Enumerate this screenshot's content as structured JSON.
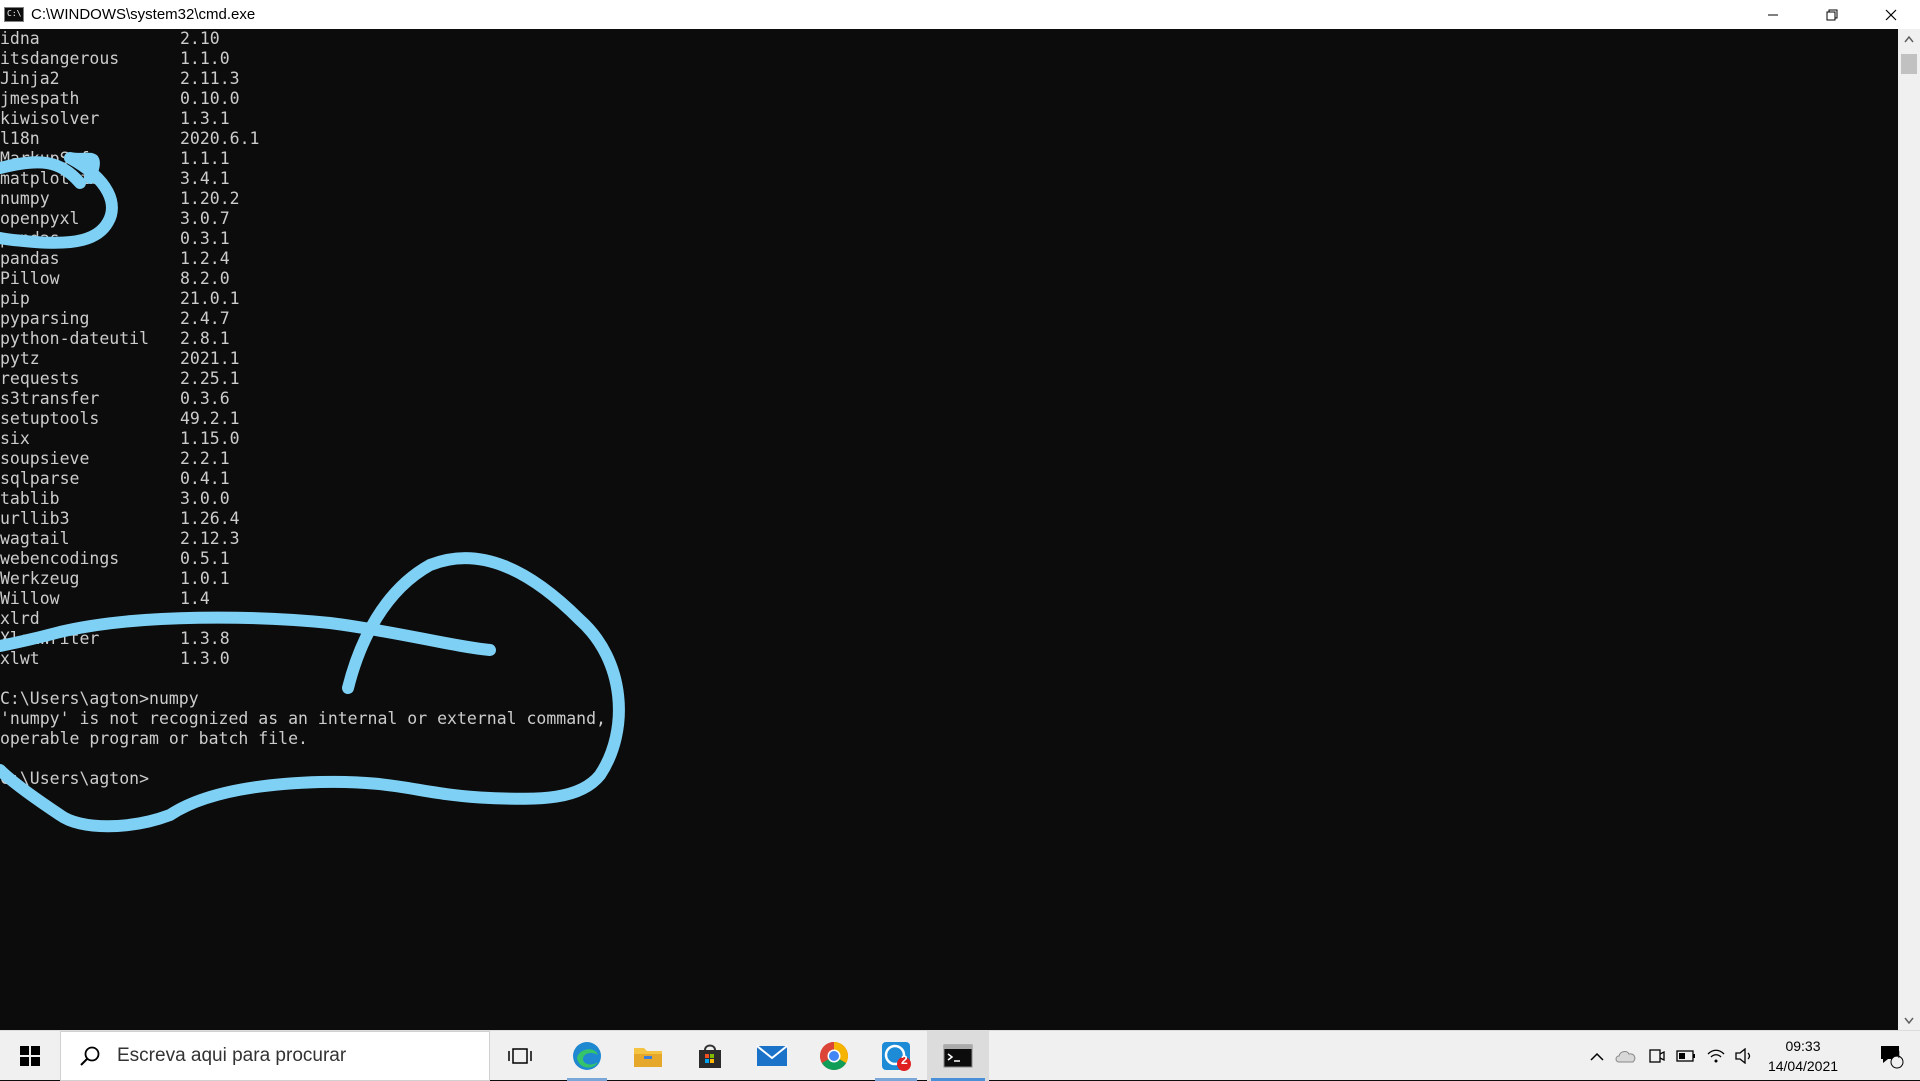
{
  "window": {
    "title": "C:\\WINDOWS\\system32\\cmd.exe",
    "icon": "cmd-icon",
    "controls": [
      "minimize-icon",
      "restore-icon",
      "close-icon"
    ]
  },
  "console": {
    "packages": [
      {
        "name": "idna",
        "version": "2.10"
      },
      {
        "name": "itsdangerous",
        "version": "1.1.0"
      },
      {
        "name": "Jinja2",
        "version": "2.11.3"
      },
      {
        "name": "jmespath",
        "version": "0.10.0"
      },
      {
        "name": "kiwisolver",
        "version": "1.3.1"
      },
      {
        "name": "l18n",
        "version": "2020.6.1"
      },
      {
        "name": "MarkupSafe",
        "version": "1.1.1"
      },
      {
        "name": "matplotlib",
        "version": "3.4.1"
      },
      {
        "name": "numpy",
        "version": "1.20.2"
      },
      {
        "name": "openpyxl",
        "version": "3.0.7"
      },
      {
        "name": "pandas",
        "version": "0.3.1"
      },
      {
        "name": "pandas",
        "version": "1.2.4"
      },
      {
        "name": "Pillow",
        "version": "8.2.0"
      },
      {
        "name": "pip",
        "version": "21.0.1"
      },
      {
        "name": "pyparsing",
        "version": "2.4.7"
      },
      {
        "name": "python-dateutil",
        "version": "2.8.1"
      },
      {
        "name": "pytz",
        "version": "2021.1"
      },
      {
        "name": "requests",
        "version": "2.25.1"
      },
      {
        "name": "s3transfer",
        "version": "0.3.6"
      },
      {
        "name": "setuptools",
        "version": "49.2.1"
      },
      {
        "name": "six",
        "version": "1.15.0"
      },
      {
        "name": "soupsieve",
        "version": "2.2.1"
      },
      {
        "name": "sqlparse",
        "version": "0.4.1"
      },
      {
        "name": "tablib",
        "version": "3.0.0"
      },
      {
        "name": "urllib3",
        "version": "1.26.4"
      },
      {
        "name": "wagtail",
        "version": "2.12.3"
      },
      {
        "name": "webencodings",
        "version": "0.5.1"
      },
      {
        "name": "Werkzeug",
        "version": "1.0.1"
      },
      {
        "name": "Willow",
        "version": "1.4"
      },
      {
        "name": "xlrd",
        "version": ""
      },
      {
        "name": "XlsxWriter",
        "version": "1.3.8"
      },
      {
        "name": "xlwt",
        "version": "1.3.0"
      }
    ],
    "after_lines": [
      "",
      "C:\\Users\\agton>numpy",
      "'numpy' is not recognized as an internal or external command,",
      "operable program or batch file.",
      "",
      "C:\\Users\\agton>"
    ],
    "annotation_color": "#7fd0f5"
  },
  "taskbar": {
    "start_icon": "windows-start-icon",
    "search_placeholder": "Escreva aqui para procurar",
    "apps": [
      {
        "name": "task-view-icon"
      },
      {
        "name": "edge-icon"
      },
      {
        "name": "file-explorer-icon"
      },
      {
        "name": "store-icon"
      },
      {
        "name": "mail-icon"
      },
      {
        "name": "chrome-icon"
      },
      {
        "name": "whatsapp-icon",
        "badge": "2"
      },
      {
        "name": "cmd-taskbar-icon",
        "active": true
      }
    ],
    "time": "09:33",
    "date": "14/04/2021",
    "notification_count": "4"
  }
}
